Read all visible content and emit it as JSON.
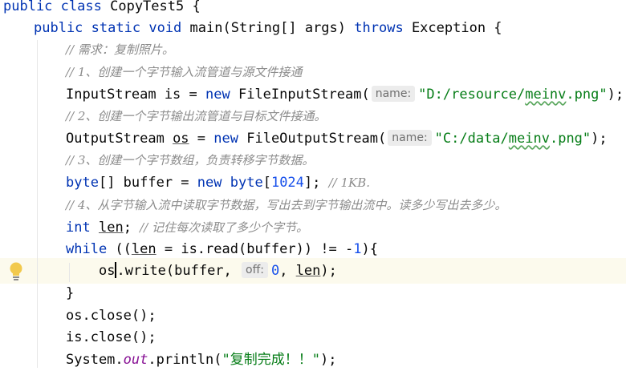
{
  "lines": {
    "l1": {
      "kw1": "public",
      "kw2": "class",
      "name": "CopyTest5 {"
    },
    "l2": {
      "kw1": "public",
      "kw2": "static",
      "kw3": "void",
      "sig": "main(String[] args)",
      "kw4": "throws",
      "rest": "Exception {"
    },
    "l3": {
      "comment": "// 需求：复制照片。"
    },
    "l4": {
      "comment": "// 1、创建一个字节输入流管道与源文件接通"
    },
    "l5": {
      "a": "InputStream is = ",
      "kw": "new",
      "b": "FileInputStream(",
      "hint": "name:",
      "str": "\"D:/resource/meinv.png\"",
      "end": ");"
    },
    "l6": {
      "comment": "// 2、创建一个字节输出流管道与目标文件接通。"
    },
    "l7": {
      "a": "OutputStream ",
      "var": "os",
      "b": " = ",
      "kw": "new",
      "c": "FileOutputStream(",
      "hint": "name:",
      "str": "\"C:/data/meinv.png\"",
      "end": ");"
    },
    "l8": {
      "comment": "// 3、创建一个字节数组，负责转移字节数据。"
    },
    "l9": {
      "kw1": "byte",
      "a": "[] buffer = ",
      "kw2": "new",
      "kw3": "byte",
      "b": "[",
      "num": "1024",
      "c": "]; ",
      "comment": "// 1KB."
    },
    "l10": {
      "comment": "// 4、从字节输入流中读取字节数据，写出去到字节输出流中。读多少写出去多少。"
    },
    "l11": {
      "kw": "int",
      "var": "len",
      "a": "; ",
      "comment": "// 记住每次读取了多少个字节。"
    },
    "l12": {
      "kw": "while",
      "a": " ((",
      "var": "len",
      "b": " = is.read(buffer)) != -",
      "num": "1",
      "c": "){"
    },
    "l13": {
      "a": "os",
      "b": ".write(buffer, ",
      "hint": "off:",
      "num": "0",
      "c": ", ",
      "var": "len",
      "d": ");"
    },
    "l14": {
      "a": "}"
    },
    "l15": {
      "a": "os.close();"
    },
    "l16": {
      "a": "is.close();"
    },
    "l17": {
      "a": "System.",
      "field": "out",
      "b": ".println(",
      "str": "\"复制完成！！\"",
      "c": ");"
    }
  },
  "icons": {
    "gutter": "lightbulb-icon"
  },
  "colors": {
    "keyword": "#0033b3",
    "string": "#067d17",
    "number": "#1750eb",
    "comment": "#8c8c8c",
    "field": "#871094",
    "current_line": "#fcfaed"
  }
}
